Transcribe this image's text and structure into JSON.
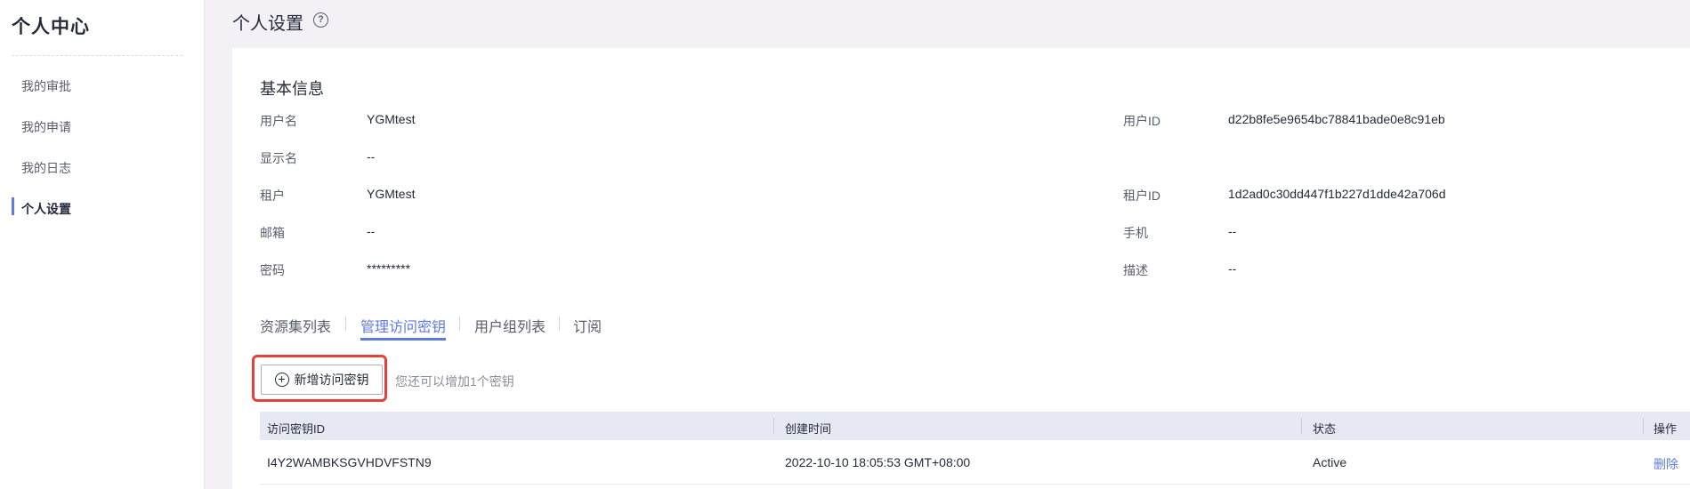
{
  "sidebar": {
    "title": "个人中心",
    "items": [
      {
        "label": "我的审批"
      },
      {
        "label": "我的申请"
      },
      {
        "label": "我的日志"
      },
      {
        "label": "个人设置"
      }
    ]
  },
  "header": {
    "title": "个人设置",
    "help_icon": "?"
  },
  "basic_info": {
    "title": "基本信息",
    "username_label": "用户名",
    "username": "YGMtest",
    "user_id_label": "用户ID",
    "user_id": "d22b8fe5e9654bc78841bade0e8c91eb",
    "display_name_label": "显示名",
    "display_name": "--",
    "tenant_label": "租户",
    "tenant": "YGMtest",
    "tenant_id_label": "租户ID",
    "tenant_id": "1d2ad0c30dd447f1b227d1dde42a706d",
    "email_label": "邮箱",
    "email": "--",
    "phone_label": "手机",
    "phone": "--",
    "password_label": "密码",
    "password": "*********",
    "description_label": "描述",
    "description": "--"
  },
  "tabs": [
    {
      "label": "资源集列表"
    },
    {
      "label": "管理访问密钥",
      "active": true
    },
    {
      "label": "用户组列表"
    },
    {
      "label": "订阅"
    }
  ],
  "access_keys": {
    "add_button_label": "新增访问密钥",
    "add_button_icon": "plus-circle-icon",
    "hint": "您还可以增加1个密钥",
    "columns": [
      "访问密钥ID",
      "创建时间",
      "状态",
      "操作"
    ],
    "rows": [
      {
        "key_id": "I4Y2WAMBKSGVHDVFSTN9",
        "created": "2022-10-10 18:05:53 GMT+08:00",
        "status": "Active",
        "action": "删除"
      }
    ]
  },
  "colors": {
    "accent": "#5e7ce0",
    "highlight": "#e5403a",
    "table_header_bg": "#e6e9f4",
    "page_bg": "#f3f1f5"
  }
}
